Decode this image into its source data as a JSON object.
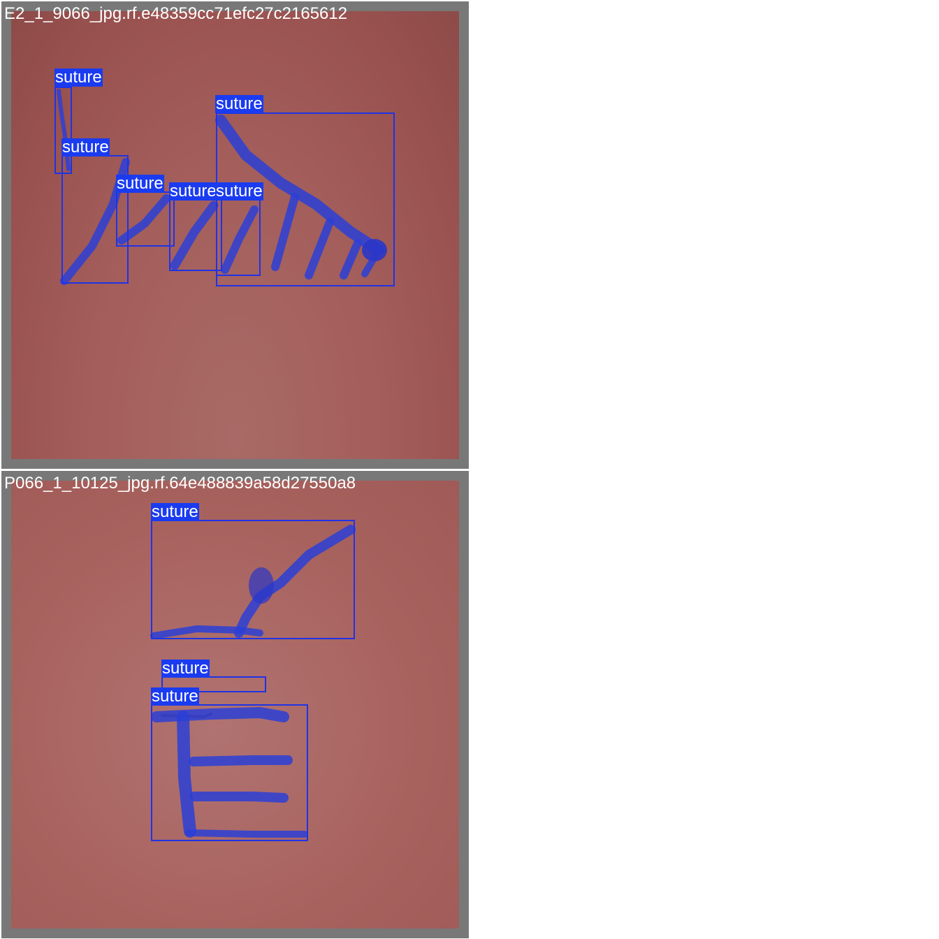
{
  "panels": [
    {
      "filename": "E2_1_9066_jpg.rf.e48359cc71efc27c2165612",
      "detections": [
        {
          "label": "suture"
        },
        {
          "label": "suture"
        },
        {
          "label": "suture"
        },
        {
          "label": "suture"
        },
        {
          "label": "suture"
        },
        {
          "label": "suture"
        }
      ]
    },
    {
      "filename": "P066_1_10125_jpg.rf.64e488839a58d27550a8",
      "detections": [
        {
          "label": "suture"
        },
        {
          "label": "suture"
        },
        {
          "label": "suture"
        }
      ]
    }
  ],
  "colors": {
    "box": "#1f33e6",
    "label_bg": "#1a3bf0",
    "frame": "#787878",
    "mask": "#2b3fd6"
  }
}
